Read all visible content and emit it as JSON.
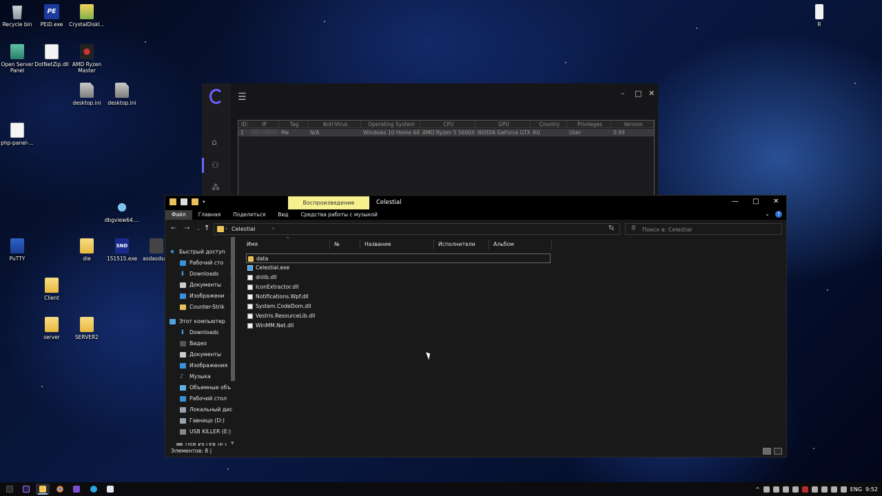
{
  "desktop": {
    "icons": [
      {
        "label": "Recycle bin"
      },
      {
        "label": "PEiD.exe",
        "glyph_text": "PE"
      },
      {
        "label": "CrystalDiskI..."
      },
      {
        "label": "Open Server Panel"
      },
      {
        "label": "DotNetZip.dll"
      },
      {
        "label": "AMD Ryzen Master"
      },
      {
        "label": "desktop.ini"
      },
      {
        "label": "desktop.ini"
      },
      {
        "label": "php-panel-..."
      },
      {
        "label": "dbgview64...."
      },
      {
        "label": "PuTTY"
      },
      {
        "label": "die"
      },
      {
        "label": "151515.exe",
        "glyph_text": "SND"
      },
      {
        "label": "asdasdsad"
      },
      {
        "label": "Client"
      },
      {
        "label": "server"
      },
      {
        "label": "SERVER2"
      },
      {
        "label": "R"
      }
    ]
  },
  "app_window": {
    "menu_icon": "☰",
    "controls": {
      "minimize": "–",
      "maximize": "□",
      "close": "✕"
    },
    "sidebar_icons": [
      "home-icon",
      "users-icon",
      "network-icon"
    ],
    "grid": {
      "columns": [
        "ID",
        "IP",
        "Tag",
        "Anti-Virus",
        "Operating System",
        "CPU",
        "GPU",
        "Country",
        "Privileges",
        "Version"
      ],
      "rows": [
        {
          "id": "1",
          "ip": "192.168.0.1",
          "tag": "Me",
          "antivirus": "N/A",
          "os": "Windows 10 Home 64",
          "cpu": "AMD Ryzen 5 5600X",
          "gpu": "NVIDIA GeForce GTX",
          "country": "RU",
          "privileges": "User",
          "version": "0.99"
        }
      ]
    }
  },
  "explorer": {
    "contextual_tab": "Воспроизведение",
    "title": "Celestial",
    "controls": {
      "minimize": "—",
      "maximize": "□",
      "close": "✕"
    },
    "ribbon_tabs": [
      "Файл",
      "Главная",
      "Поделиться",
      "Вид",
      "Средства работы с музыкой"
    ],
    "address": {
      "path": "Celestial",
      "separator": "›"
    },
    "search_placeholder": "Поиск в: Celestial",
    "nav": {
      "quick_access": "Быстрый доступ",
      "quick_items": [
        "Рабочий сто",
        "Downloads",
        "Документы",
        "Изображени",
        "Counter-Strik"
      ],
      "this_pc": "Этот компьютер",
      "pc_items": [
        "Downloads",
        "Видео",
        "Документы",
        "Изображения",
        "Музыка",
        "Объемные объ",
        "Рабочий стол",
        "Локальный дис",
        "Гавницо (D:)",
        "USB KILLER (E:)",
        "USB KILLER (E:)"
      ]
    },
    "columns": [
      "Имя",
      "№",
      "Название",
      "Исполнители",
      "Альбом"
    ],
    "files": [
      {
        "name": "data",
        "type": "folder"
      },
      {
        "name": "Celestial.exe",
        "type": "exe"
      },
      {
        "name": "dnlib.dll",
        "type": "dll"
      },
      {
        "name": "IconExtractor.dll",
        "type": "dll"
      },
      {
        "name": "Notifications.Wpf.dll",
        "type": "dll"
      },
      {
        "name": "System.CodeDom.dll",
        "type": "dll"
      },
      {
        "name": "Vestris.ResourceLib.dll",
        "type": "dll"
      },
      {
        "name": "WinMM.Net.dll",
        "type": "dll"
      }
    ],
    "status": "Элементов: 8  |"
  },
  "taskbar": {
    "apps": [
      "start",
      "after-effects",
      "file-explorer",
      "chrome",
      "visual-studio",
      "telegram",
      "app"
    ],
    "tray": {
      "language": "ENG",
      "time": "9:52"
    }
  }
}
